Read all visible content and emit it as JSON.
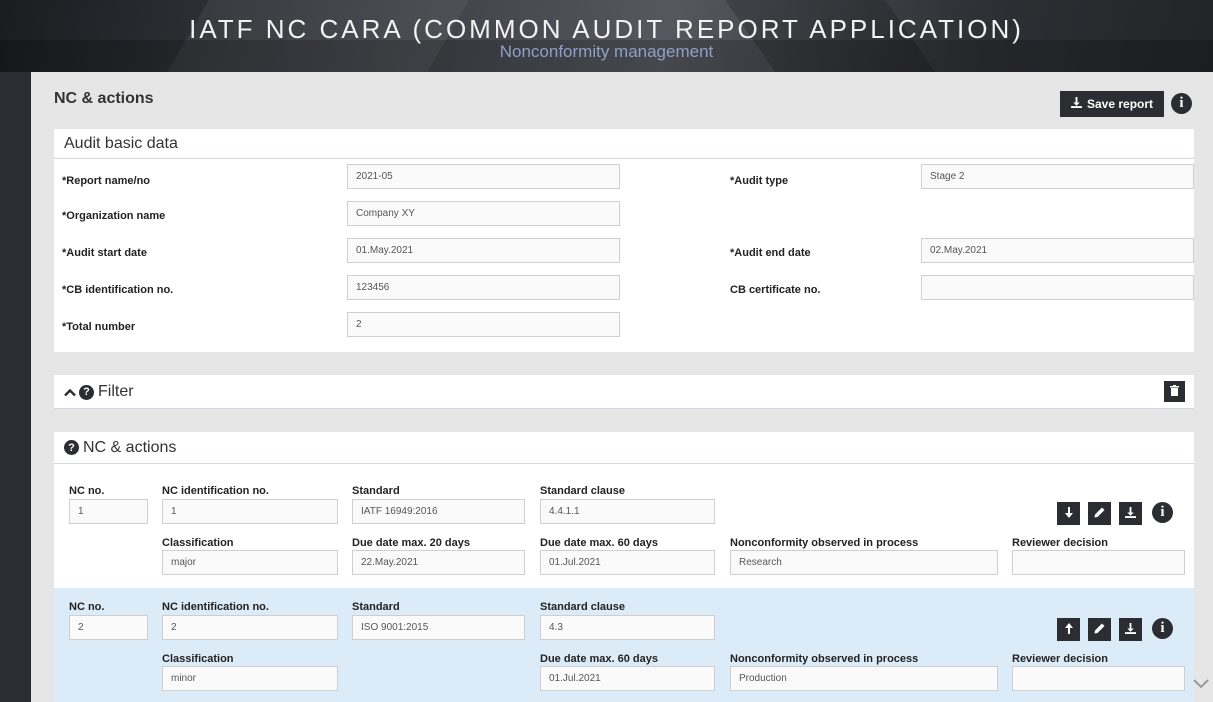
{
  "header": {
    "title": "IATF NC CARA (COMMON AUDIT REPORT APPLICATION)",
    "subtitle": "Nonconformity management"
  },
  "page": {
    "title": "NC & actions",
    "save_label": "Save report",
    "info_glyph": "i"
  },
  "audit": {
    "title": "Audit basic data",
    "report_label": "*Report name/no",
    "report_value": "2021-05",
    "org_label": "*Organization name",
    "org_value": "Company XY",
    "start_label": "*Audit start date",
    "start_value": "01.May.2021",
    "cb_id_label": "*CB identification no.",
    "cb_id_value": "123456",
    "total_label": "*Total number",
    "total_value": "2",
    "type_label": "*Audit type",
    "type_value": "Stage 2",
    "end_label": "*Audit end date",
    "end_value": "02.May.2021",
    "cert_label": "CB certificate no.",
    "cert_value": ""
  },
  "filter": {
    "title": "Filter"
  },
  "nc": {
    "title": "NC & actions",
    "col_no": "NC no.",
    "col_id": "NC identification no.",
    "col_standard": "Standard",
    "col_clause": "Standard clause",
    "col_class": "Classification",
    "col_due20": "Due date max. 20 days",
    "col_due60": "Due date max. 60 days",
    "col_process": "Nonconformity observed in process",
    "col_reviewer": "Reviewer decision",
    "rows": [
      {
        "no": "1",
        "id": "1",
        "standard": "IATF 16949:2016",
        "clause": "4.4.1.1",
        "classification": "major",
        "due20": "22.May.2021",
        "due60": "01.Jul.2021",
        "process": "Research",
        "reviewer": ""
      },
      {
        "no": "2",
        "id": "2",
        "standard": "ISO 9001:2015",
        "clause": "4.3",
        "classification": "minor",
        "due60": "01.Jul.2021",
        "process": "Production",
        "reviewer": ""
      }
    ]
  },
  "icons": {
    "arrow_down": "arrow-down-icon",
    "arrow_up": "arrow-up-icon",
    "edit": "pencil-icon",
    "download": "download-icon",
    "trash": "trash-icon",
    "info": "info-icon",
    "help": "question-icon",
    "chevron_up": "chevron-up-icon"
  },
  "colors": {
    "dark": "#2b2d33",
    "highlight_row": "#dcebf8",
    "subtitle": "#8f9fc6"
  }
}
